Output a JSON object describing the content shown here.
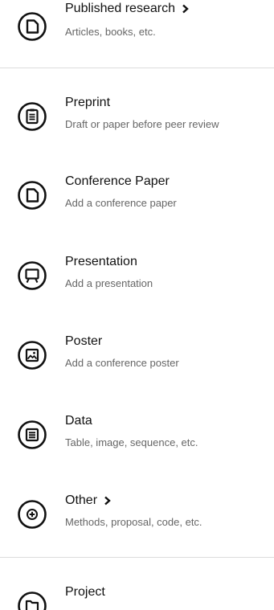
{
  "menu": {
    "published": {
      "title": "Published research",
      "subtitle": "Articles, books, etc."
    },
    "preprint": {
      "title": "Preprint",
      "subtitle": "Draft or paper before peer review"
    },
    "conference": {
      "title": "Conference Paper",
      "subtitle": "Add a conference paper"
    },
    "presentation": {
      "title": "Presentation",
      "subtitle": "Add a presentation"
    },
    "poster": {
      "title": "Poster",
      "subtitle": "Add a conference poster"
    },
    "data": {
      "title": "Data",
      "subtitle": "Table, image, sequence, etc."
    },
    "other": {
      "title": "Other",
      "subtitle": "Methods, proposal, code, etc."
    },
    "project": {
      "title": "Project"
    }
  },
  "icons": {
    "published": "document-icon",
    "preprint": "clipboard-icon",
    "conference": "document-icon",
    "presentation": "presentation-icon",
    "poster": "poster-icon",
    "data": "data-list-icon",
    "other": "plus-circle-icon",
    "project": "folder-icon",
    "chevron": "chevron-right-icon"
  },
  "colors": {
    "text": "#111111",
    "subtext": "#666666",
    "divider": "#dcdcdc"
  }
}
